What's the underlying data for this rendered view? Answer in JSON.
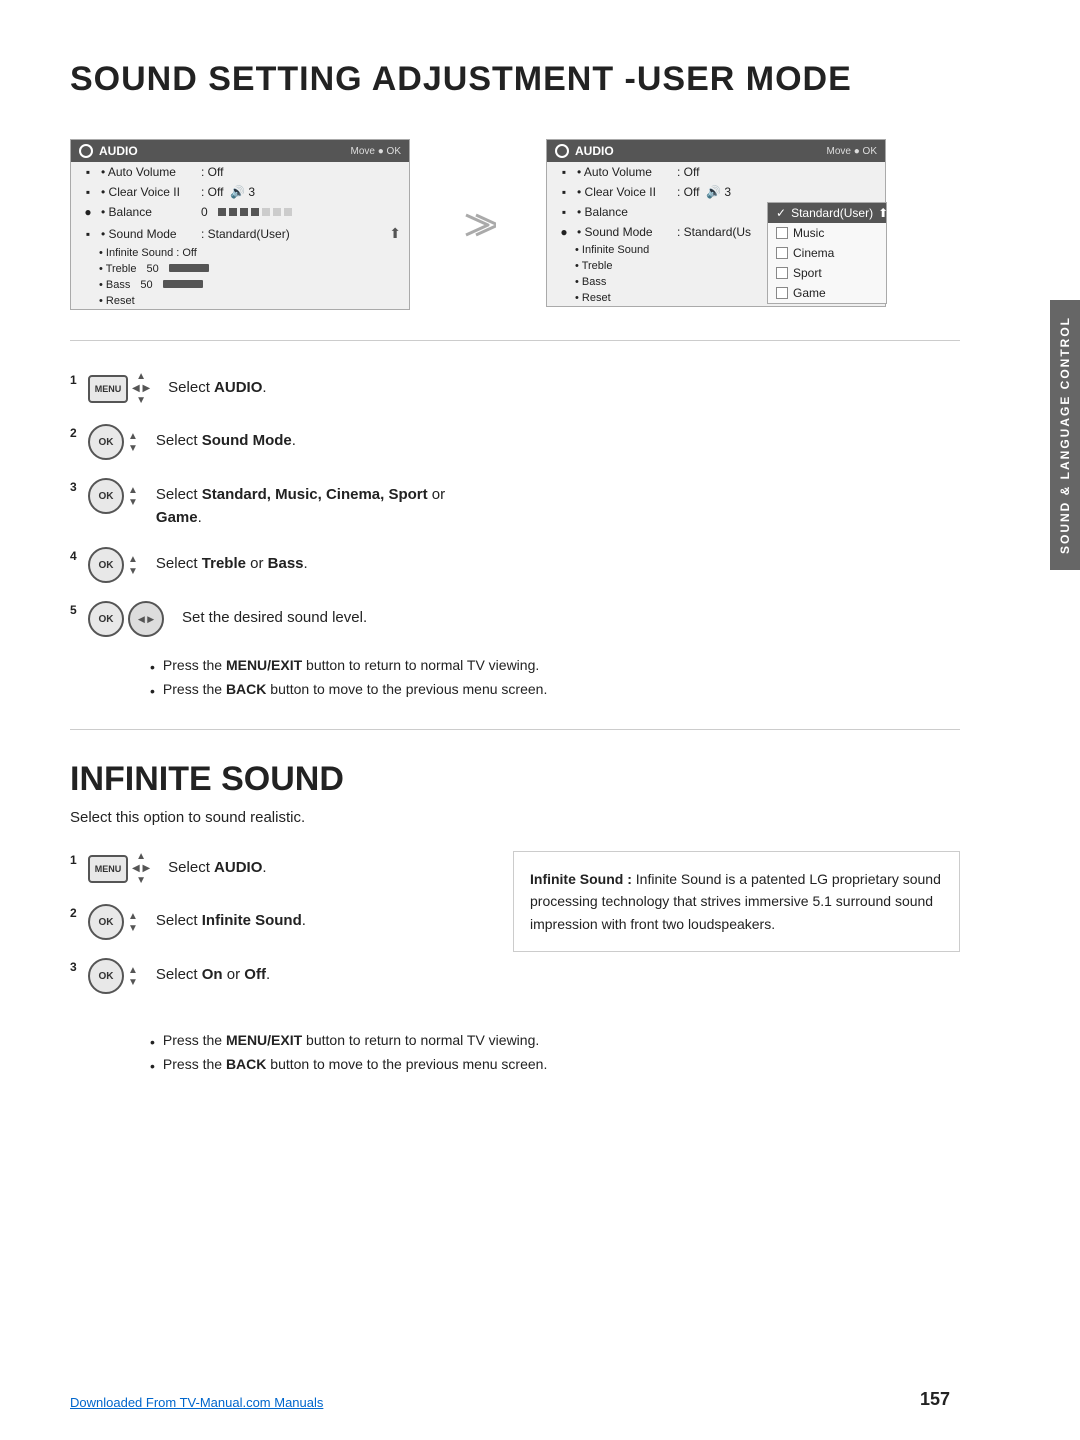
{
  "page": {
    "title": "SOUND SETTING ADJUSTMENT -USER MODE",
    "page_number": "157",
    "footer_link": "Downloaded From TV-Manual.com Manuals"
  },
  "audio_screen1": {
    "header": "AUDIO",
    "move_label": "Move ● OK",
    "rows": [
      {
        "label": "• Auto Volume",
        "value": ": Off"
      },
      {
        "label": "• Clear Voice II",
        "value": ": Off  🔊 3"
      },
      {
        "label": "• Balance",
        "value": "0"
      },
      {
        "label": "• Sound Mode",
        "value": ": Standard(User)"
      }
    ],
    "sub_rows": [
      {
        "label": "• Infinite Sound",
        "value": ": Off"
      },
      {
        "label": "• Treble",
        "value": "50"
      },
      {
        "label": "• Bass",
        "value": "50"
      },
      {
        "label": "• Reset",
        "value": ""
      }
    ]
  },
  "audio_screen2": {
    "header": "AUDIO",
    "move_label": "Move ● OK",
    "dropdown_items": [
      {
        "label": "Standard(User)",
        "selected": true
      },
      {
        "label": "Music",
        "selected": false
      },
      {
        "label": "Cinema",
        "selected": false
      },
      {
        "label": "Sport",
        "selected": false
      },
      {
        "label": "Game",
        "selected": false
      }
    ]
  },
  "steps_sound_mode": [
    {
      "num": "1",
      "button": "MENU",
      "text": "Select AUDIO.",
      "bold_parts": [
        "AUDIO"
      ]
    },
    {
      "num": "2",
      "button": "OK",
      "text": "Select Sound Mode.",
      "bold_parts": [
        "Sound Mode"
      ]
    },
    {
      "num": "3",
      "button": "OK",
      "text": "Select Standard, Music, Cinema, Sport or Game.",
      "bold_parts": [
        "Standard, Music, Cinema, Sport",
        "Game"
      ]
    },
    {
      "num": "4",
      "button": "OK",
      "text": "Select Treble or Bass.",
      "bold_parts": [
        "Treble",
        "Bass"
      ]
    },
    {
      "num": "5",
      "button": "OK",
      "text": "Set the desired sound level.",
      "bold_parts": []
    }
  ],
  "sound_mode_notes": [
    "Press the MENU/EXIT button to return to normal TV viewing.",
    "Press the BACK button to move to the previous menu screen."
  ],
  "infinite_sound": {
    "title": "INFINITE SOUND",
    "subtitle": "Select this option to sound realistic.",
    "steps": [
      {
        "num": "1",
        "button": "MENU",
        "text": "Select AUDIO.",
        "bold_parts": [
          "AUDIO"
        ]
      },
      {
        "num": "2",
        "button": "OK",
        "text": "Select Infinite Sound.",
        "bold_parts": [
          "Infinite Sound"
        ]
      },
      {
        "num": "3",
        "button": "OK",
        "text": "Select On or Off.",
        "bold_parts": [
          "On",
          "Off"
        ]
      }
    ],
    "info_box": "Infinite Sound : Infinite Sound is a patented LG proprietary sound processing technology that strives immersive 5.1 surround sound impression with front two loudspeakers.",
    "notes": [
      "Press the MENU/EXIT button to return to normal TV viewing.",
      "Press the BACK button to move to the previous menu screen."
    ]
  },
  "side_label": "SOUND & LANGUAGE CONTROL"
}
